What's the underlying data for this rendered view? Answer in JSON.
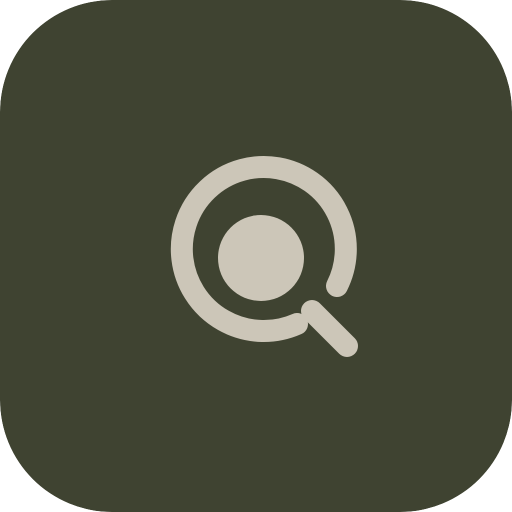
{
  "app_icon": {
    "icon": "search-lens-icon",
    "colors": {
      "background": "#3F4331",
      "glyph": "#CCC6B8"
    }
  }
}
